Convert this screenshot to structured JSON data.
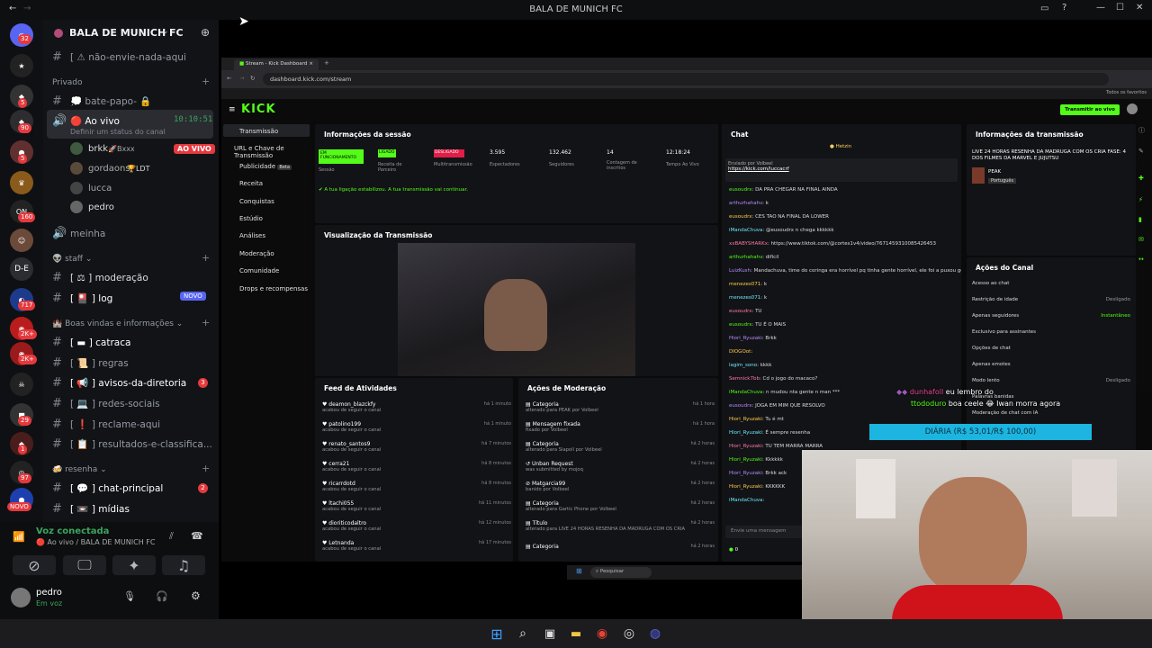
{
  "window": {
    "title": "BALA DE MUNICH FC"
  },
  "server": {
    "name": "BALA DE MUNICH FC"
  },
  "channels": {
    "top": "não-envie-nada-aqui",
    "cat_privado": "Privado",
    "bate_papo": "bate-papo-",
    "ao_vivo": "Ao vivo",
    "ao_vivo_time": "10:10:51",
    "ao_vivo_status": "Definir um status do canal",
    "voice_users": [
      {
        "name": "brkk",
        "tag": "Bxxx",
        "live": "AO VIVO"
      },
      {
        "name": "gordaons",
        "tag": "LDT"
      },
      {
        "name": "lucca"
      },
      {
        "name": "pedro"
      }
    ],
    "meinha": "meinha",
    "cat_staff": "staff",
    "moderacao": "moderação",
    "log": "log",
    "log_badge": "NOVO",
    "cat_boas": "Boas vindas e informações",
    "catraca": "catraca",
    "regras": "regras",
    "avisos": "avisos-da-diretoria",
    "avisos_count": "3",
    "redes": "redes-sociais",
    "reclame": "reclame-aqui",
    "resultados": "resultados-e-classifica...",
    "cat_resenha": "resenha",
    "chat_principal": "chat-principal",
    "chat_count": "2",
    "midias": "mídias"
  },
  "guild_badges": [
    "32",
    "5",
    "5",
    "90",
    "5",
    "160",
    "717",
    "2K+",
    "2K+",
    "29",
    "1",
    "97",
    "NOVO"
  ],
  "guild_labels": {
    "de": "D-E"
  },
  "voice": {
    "status": "Voz conectada",
    "channel": "Ao vivo / BALA DE MUNICH FC"
  },
  "user": {
    "name": "pedro",
    "status": "Em voz"
  },
  "browser": {
    "tab": "Stream - Kick Dashboard",
    "url": "dashboard.kick.com/stream",
    "bookmarks": "Todos os favoritos"
  },
  "kick": {
    "logo": "KICK",
    "live_button": "Transmitir ao vivo",
    "nav": [
      "Transmissão",
      "URL e Chave de Transmissão",
      "Publicidade",
      "Receita",
      "Conquistas",
      "Estúdio",
      "Análises",
      "Moderação",
      "Comunidade",
      "Drops e recompensas"
    ],
    "nav_beta": "Beta",
    "session_title": "Informações da sessão",
    "session": {
      "state1": "EM FUNCIONAMENTO",
      "label1": "Sessão",
      "state2": "LIGADO",
      "label2": "Receita de Parceiro",
      "state3": "DESLIGADO",
      "label3": "Multitransmissão",
      "viewers": "3.595",
      "viewers_l": "Espectadores",
      "followers": "132.462",
      "followers_l": "Seguidores",
      "subs": "14",
      "subs_l": "Contagem de inscritos",
      "time": "12:18:24",
      "time_l": "Tempo Ao Vivo"
    },
    "connected": "A tua ligação estabilizou. A tua transmissão vai continuar.",
    "preview_title": "Visualização da Transmissão",
    "feed_title": "Feed de Atividades",
    "feed": [
      {
        "name": "deamon_blazckfy",
        "sub": "acabou de seguir o canal",
        "time": "há 1 minuto"
      },
      {
        "name": "patolino199",
        "sub": "acabou de seguir o canal",
        "time": "há 1 minuto"
      },
      {
        "name": "renato_santos9",
        "sub": "acabou de seguir o canal",
        "time": "há 7 minutos"
      },
      {
        "name": "cerra21",
        "sub": "acabou de seguir o canal",
        "time": "há 8 minutos"
      },
      {
        "name": "ricarrdotd",
        "sub": "acabou de seguir o canal",
        "time": "há 8 minutos"
      },
      {
        "name": "ltachi055",
        "sub": "acabou de seguir o canal",
        "time": "há 11 minutos"
      },
      {
        "name": "dioriticodaltro",
        "sub": "acabou de seguir o canal",
        "time": "há 12 minutos"
      },
      {
        "name": "Letnanda",
        "sub": "acabou de seguir o canal",
        "time": "há 17 minutos"
      }
    ],
    "mod_title": "Ações de Moderação",
    "mod": [
      {
        "name": "Categoria",
        "sub": "alterado para PEAK por Volbeel",
        "time": "há 1 hora"
      },
      {
        "name": "Mensagem fixada",
        "sub": "fixado por Volbeel",
        "time": "há 1 hora"
      },
      {
        "name": "Categoria",
        "sub": "alterado para Slapoll por Volbeel",
        "time": "há 2 horas"
      },
      {
        "name": "Unban Request",
        "sub": "was submitted by mojoq",
        "time": "há 2 horas"
      },
      {
        "name": "Matgarcia99",
        "sub": "banido por Volbeel",
        "time": "há 2 horas"
      },
      {
        "name": "Categoria",
        "sub": "alterado para Gartic Phone por Volbeel",
        "time": "há 2 horas"
      },
      {
        "name": "Título",
        "sub": "alterado para LIVE 24 HORAS RESENHA DA MADRUGA COM OS CRIA",
        "time": "há 2 horas"
      },
      {
        "name": "Categoria",
        "sub": "",
        "time": "há 2 horas"
      }
    ],
    "chat_title": "Chat",
    "chat_pinned_by": "Enviado por Volbeel",
    "chat_pinned_link": "https://kick.com/luccacrf",
    "chat": [
      {
        "u": "eusoudrx",
        "m": "DA PRA CHEGAR NA FINAL AINDA"
      },
      {
        "u": "arthurhahahv",
        "m": "k"
      },
      {
        "u": "eusoudrx",
        "m": "CES TAO NA FINAL DA LOWER"
      },
      {
        "u": "iMandaChuva",
        "m": "@eusoudrx n chega kkkkkk"
      },
      {
        "u": "xxBABYSHARKx",
        "m": "https://www.tiktok.com/@cortes1v4/video/7671459310085426453"
      },
      {
        "u": "arthurhahahv",
        "m": "difícil"
      },
      {
        "u": "LuizKush",
        "m": "Mandachuva, time do coringa era horrível pq tinha gente horrível, ele foi a puxou gente q sabe jogar kk"
      },
      {
        "u": "menezes071",
        "m": "k"
      },
      {
        "u": "menezes071",
        "m": "k"
      },
      {
        "u": "eusoudrx",
        "m": "TU"
      },
      {
        "u": "eusoudrx",
        "m": "TU É O MAIS"
      },
      {
        "u": "Hiori_Ryuzaki",
        "m": "Brkk"
      },
      {
        "u": "DIOGOot",
        "m": ""
      },
      {
        "u": "lagim_sono",
        "m": "kkkk"
      },
      {
        "u": "Semnick7bb",
        "m": "Cd o jogo do macaco?"
      },
      {
        "u": "iMandaChuva",
        "m": "n mudou nta gente n man ***"
      },
      {
        "u": "eusoudrx",
        "m": "JOGA EM MIM QUE RESOLVO"
      },
      {
        "u": "Hiori_Ryuzaki",
        "m": "Tu é mt"
      },
      {
        "u": "Hiori_Ryuzaki",
        "m": "É sempre resenha"
      },
      {
        "u": "Hiori_Ryuzaki",
        "m": "TU TEM MARRA MARRA"
      },
      {
        "u": "Hiori_Ryuzaki",
        "m": "Kkkkkk"
      },
      {
        "u": "Hiori_Ryuzaki",
        "m": "Brkk ack"
      },
      {
        "u": "Hiori_Ryuzaki",
        "m": "KKKKKK"
      },
      {
        "u": "iMandaChuva",
        "m": ""
      }
    ],
    "chat_input": "Envie uma mensagem",
    "chat_zero": "0",
    "stream_info_title": "Informações da transmissão",
    "stream_info_text": "LIVE 24 HORAS RESENHA DA MADRUGA COM OS CRIA FASE: 4 DOS FILMES DA MARVEL E JUJUTSU",
    "stream_cat": "PEAK",
    "stream_lang": "Português",
    "actions_title": "Ações do Canal",
    "actions": [
      {
        "label": "Acesso ao chat",
        "value": ""
      },
      {
        "label": "Restrição de idade",
        "value": "Desligado"
      },
      {
        "label": "Apenas seguidores",
        "value": "Instantâneo"
      },
      {
        "label": "Exclusivo para assinantes",
        "value": ""
      },
      {
        "label": "Opções de chat",
        "value": ""
      },
      {
        "label": "Apenas emotes",
        "value": ""
      },
      {
        "label": "Modo lento",
        "value": "Desligado"
      },
      {
        "label": "Palavras banidas",
        "value": ""
      },
      {
        "label": "Moderação de chat com IA",
        "value": ""
      },
      {
        "label": "Mostrar número de visualizações",
        "value": ""
      }
    ],
    "helper": "Hetzin"
  },
  "overlay": {
    "msg1_user": "eu lembro do",
    "msg2_user": "ttododuro",
    "msg2_text": "boa ceele",
    "msg3": "Iwan morra agora",
    "bar": "DIÁRIA (R$ 53,01/R$ 100,00)"
  },
  "inner_taskbar": {
    "search": "Pesquisar"
  }
}
